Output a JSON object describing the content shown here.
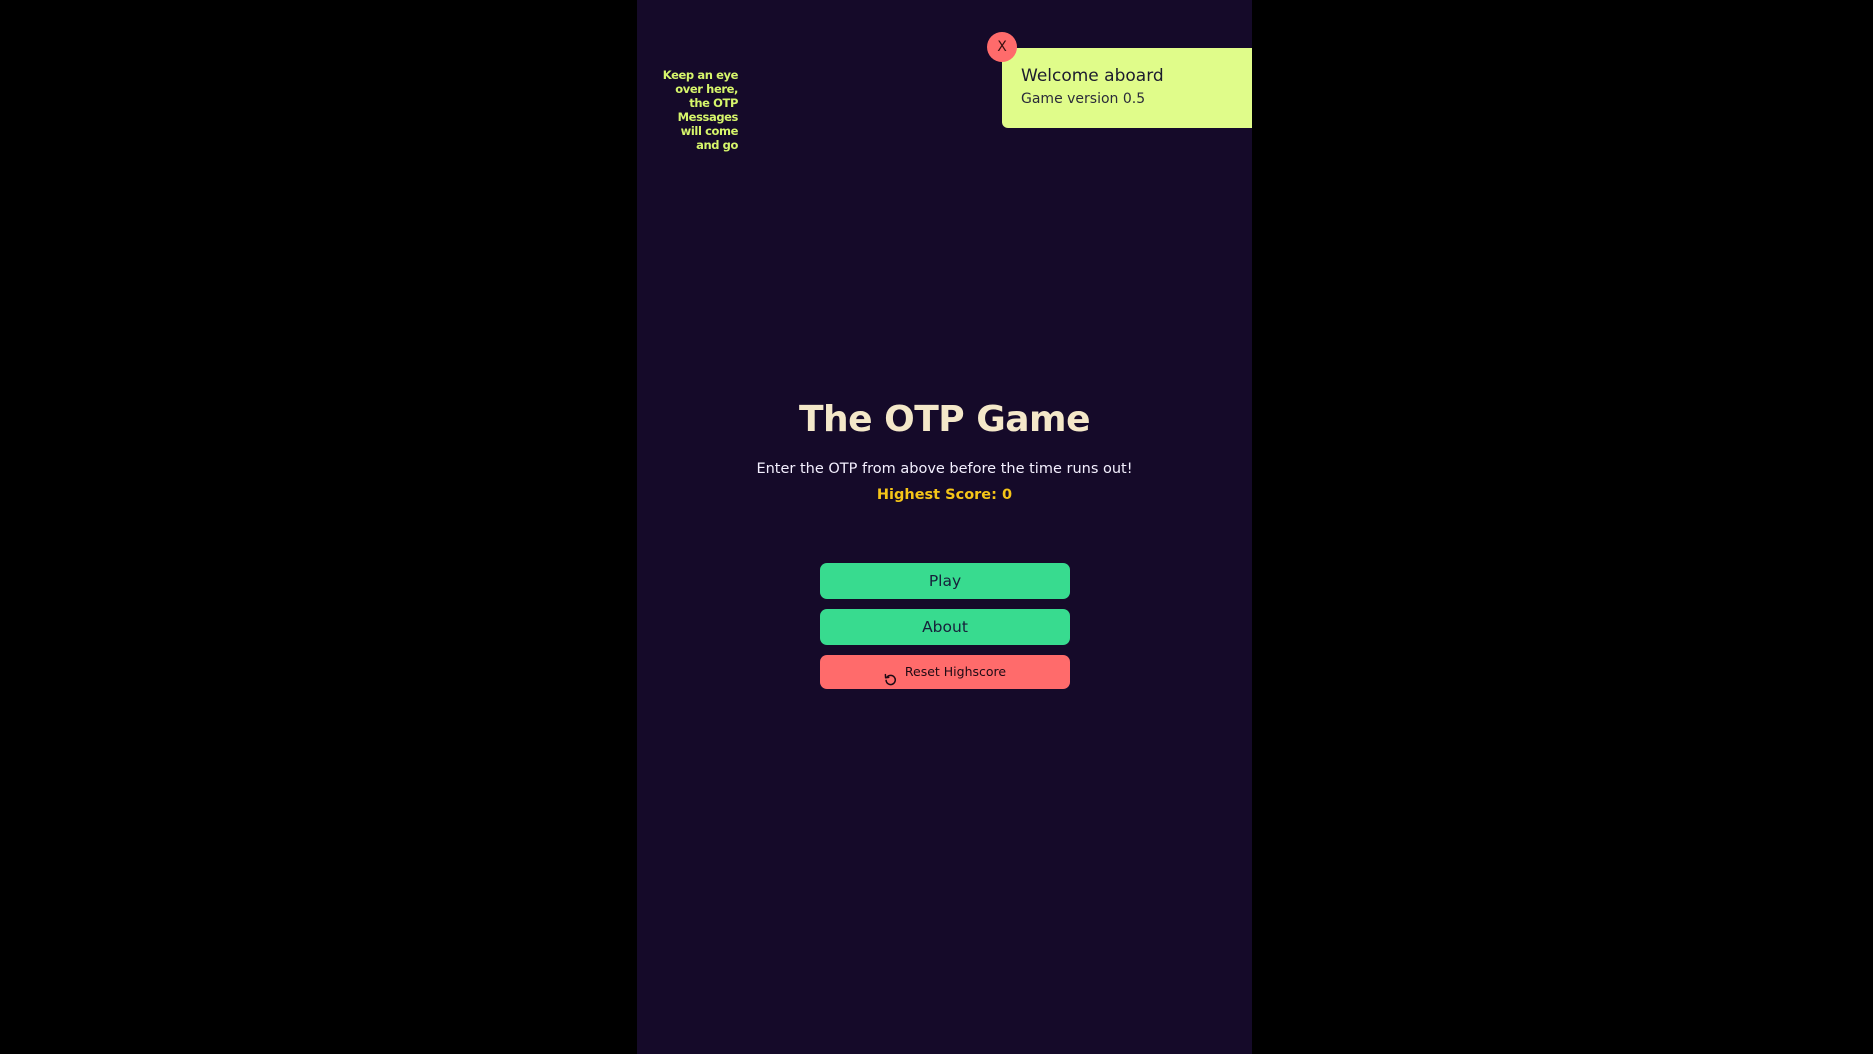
{
  "hint": {
    "text": "Keep an eye over here, the OTP Messages will come and go"
  },
  "toast": {
    "title": "Welcome aboard",
    "subtitle": "Game version 0.5",
    "close_label": "X"
  },
  "main": {
    "title": "The OTP Game",
    "tagline": "Enter the OTP from above before the time runs out!",
    "highscore": "Highest Score: 0"
  },
  "buttons": {
    "play": "Play",
    "about": "About",
    "reset": "Reset Highscore",
    "reset_icon": "rotate-ccw-icon"
  },
  "colors": {
    "background": "#150a29",
    "accent_green": "#38db8f",
    "danger_red": "#ff6b6b",
    "toast_bg": "#e0fc8a",
    "score_yellow": "#f5c518",
    "hint_text": "#d6f56b"
  }
}
